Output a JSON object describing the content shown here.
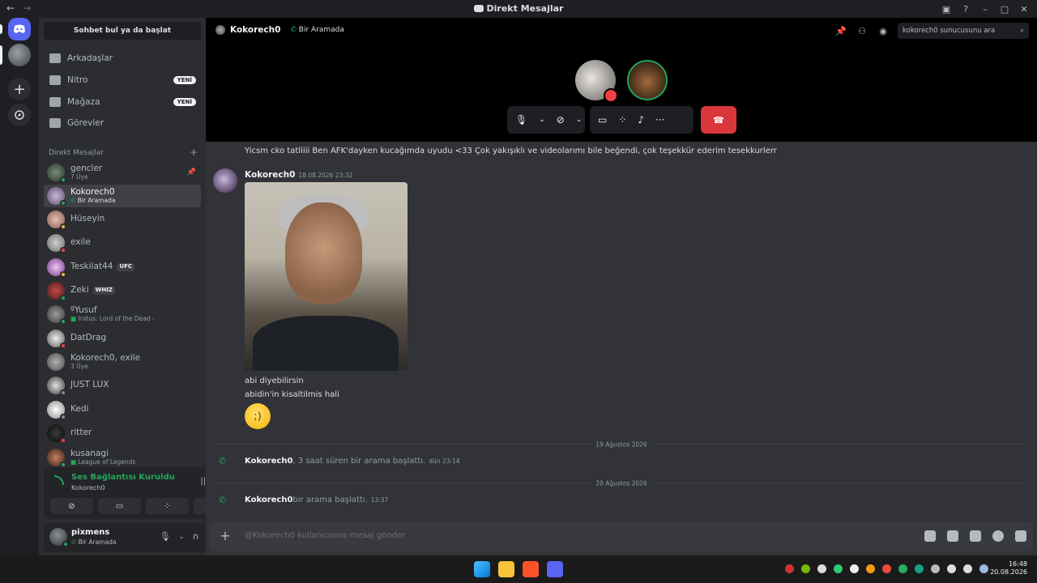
{
  "window": {
    "title": "Direkt Mesajlar"
  },
  "sidebar": {
    "search_label": "Sohbet bul ya da başlat",
    "nav": [
      {
        "label": "Arkadaşlar",
        "badge": ""
      },
      {
        "label": "Nitro",
        "badge": "YENİ"
      },
      {
        "label": "Mağaza",
        "badge": "YENİ"
      },
      {
        "label": "Görevler",
        "badge": ""
      }
    ],
    "dm_header": "Direkt Mesajlar",
    "dms": [
      {
        "name": "gencler",
        "sub": "7 Üye",
        "status": "on",
        "tag": ""
      },
      {
        "name": "Kokorech0",
        "sub": "Bir Aramada",
        "status": "on",
        "tag": ""
      },
      {
        "name": "Hüseyin",
        "sub": "",
        "status": "idle",
        "tag": ""
      },
      {
        "name": "exile",
        "sub": "",
        "status": "dnd",
        "tag": ""
      },
      {
        "name": "Teskilat44",
        "sub": "",
        "status": "idle",
        "tag": "UFC"
      },
      {
        "name": "Zeki",
        "sub": "",
        "status": "on",
        "tag": "WHIZ"
      },
      {
        "name": "ºYusuf",
        "sub": "Iratus: Lord of the Dead -",
        "status": "on",
        "tag": ""
      },
      {
        "name": "DatDrag",
        "sub": "",
        "status": "dnd",
        "tag": ""
      },
      {
        "name": "Kokorech0, exile",
        "sub": "3 Üye",
        "status": "",
        "tag": ""
      },
      {
        "name": "JUST LUX",
        "sub": "",
        "status": "off",
        "tag": ""
      },
      {
        "name": "Kedi",
        "sub": "",
        "status": "off",
        "tag": ""
      },
      {
        "name": "ritter",
        "sub": "",
        "status": "dnd",
        "tag": ""
      },
      {
        "name": "kusanagi",
        "sub": "League of Legends",
        "status": "on",
        "tag": ""
      }
    ]
  },
  "voice": {
    "status": "Ses Bağlantısı Kuruldu",
    "channel": "Kokorech0"
  },
  "user": {
    "name": "pixmens",
    "status": "Bir Aramada"
  },
  "channel": {
    "name": "Kokorech0",
    "status": "Bir Aramada",
    "search_placeholder": "kokorech0 sunucusunu ara"
  },
  "messages": {
    "prev_line": "Yicsm cko tatliiii Ben AFK'dayken kucağımda uyudu <33 Çok yakışıklı ve videolarımı bile beğendi, çok teşekkür ederim tesekkurlerr",
    "author": "Kokorech0",
    "timestamp": "18.08.2026 23:32",
    "line1": "abi diyebilirsin",
    "line2": "abidin'in kisaltilmis hali",
    "emoji": "wink-emoji",
    "divider1": "19 Ağustos 2026",
    "sys1_name": "Kokorech0",
    "sys1_text": ", 3 saat süren bir arama başlattı.",
    "sys1_time": "dün 23:14",
    "divider2": "20 Ağustos 2026",
    "sys2_name": "Kokorech0",
    "sys2_text": " bir arama başlattı.",
    "sys2_time": "13:37"
  },
  "composer": {
    "placeholder": "@Kokorech0 kullanıcısına mesaj gönder"
  },
  "taskbar": {
    "time": "16:48",
    "date": "20.08.2026"
  },
  "colors": {
    "accent": "#5865f2",
    "online": "#23a55a",
    "danger": "#da373c"
  }
}
